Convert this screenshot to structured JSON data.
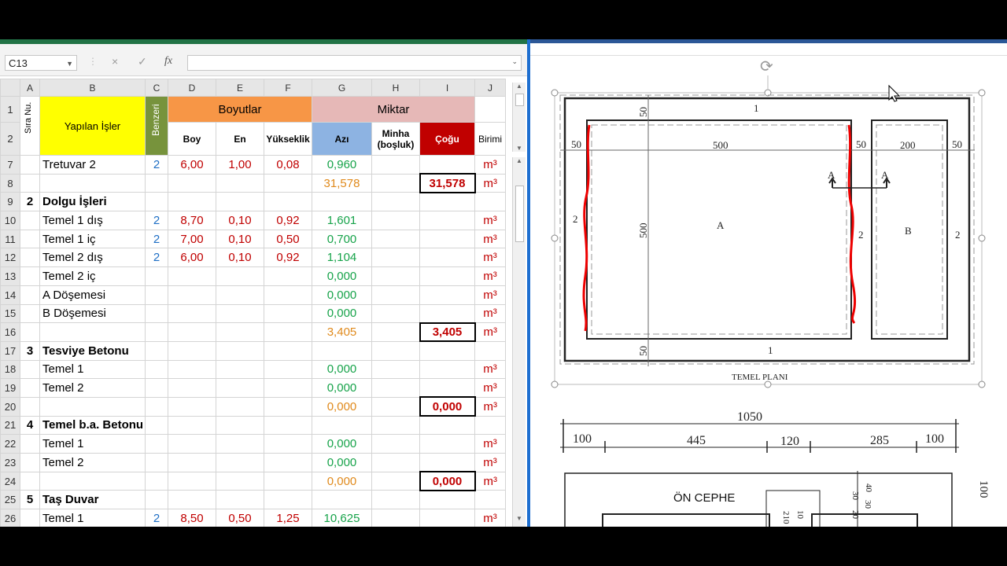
{
  "formula_bar": {
    "cell_ref": "C13",
    "cancel_glyph": "×",
    "enter_glyph": "✓",
    "fx_label": "fx",
    "formula": ""
  },
  "columns": [
    "A",
    "B",
    "C",
    "D",
    "E",
    "F",
    "G",
    "H",
    "I",
    "J"
  ],
  "header": {
    "sira_nu": "Sıra Nu.",
    "yapilan_isler": "Yapılan İşler",
    "benzeri": "Benzeri",
    "boyutlar": "Boyutlar",
    "miktar": "Miktar",
    "boy": "Boy",
    "en": "En",
    "yukseklik": "Yükseklik",
    "azi": "Azı",
    "minha": "Minha (boşluk)",
    "cogu": "Çoğu",
    "birimi": "Birimi",
    "row1": "1",
    "row2": "2"
  },
  "rows": [
    {
      "row": "7",
      "a": "",
      "b": "Tretuvar 2",
      "c": "2",
      "d": "6,00",
      "e": "1,00",
      "f": "0,08",
      "g": "0,960",
      "g_color": "green",
      "h": "",
      "i": "",
      "i_box": false,
      "j": "m³",
      "bold": false
    },
    {
      "row": "8",
      "a": "",
      "b": "",
      "c": "",
      "d": "",
      "e": "",
      "f": "",
      "g": "31,578",
      "g_color": "orange",
      "h": "",
      "i": "31,578",
      "i_box": true,
      "j": "m³",
      "bold": false
    },
    {
      "row": "9",
      "a": "2",
      "b": "Dolgu İşleri",
      "c": "",
      "d": "",
      "e": "",
      "f": "",
      "g": "",
      "g_color": "",
      "h": "",
      "i": "",
      "i_box": false,
      "j": "",
      "bold": true
    },
    {
      "row": "10",
      "a": "",
      "b": "Temel 1 dış",
      "c": "2",
      "d": "8,70",
      "e": "0,10",
      "f": "0,92",
      "g": "1,601",
      "g_color": "green",
      "h": "",
      "i": "",
      "i_box": false,
      "j": "m³",
      "bold": false
    },
    {
      "row": "11",
      "a": "",
      "b": "Temel 1 iç",
      "c": "2",
      "d": "7,00",
      "e": "0,10",
      "f": "0,50",
      "g": "0,700",
      "g_color": "green",
      "h": "",
      "i": "",
      "i_box": false,
      "j": "m³",
      "bold": false
    },
    {
      "row": "12",
      "a": "",
      "b": "Temel 2 dış",
      "c": "2",
      "d": "6,00",
      "e": "0,10",
      "f": "0,92",
      "g": "1,104",
      "g_color": "green",
      "h": "",
      "i": "",
      "i_box": false,
      "j": "m³",
      "bold": false
    },
    {
      "row": "13",
      "a": "",
      "b": "Temel 2 iç",
      "c": "",
      "d": "",
      "e": "",
      "f": "",
      "g": "0,000",
      "g_color": "green",
      "h": "",
      "i": "",
      "i_box": false,
      "j": "m³",
      "bold": false
    },
    {
      "row": "14",
      "a": "",
      "b": "A Döşemesi",
      "c": "",
      "d": "",
      "e": "",
      "f": "",
      "g": "0,000",
      "g_color": "green",
      "h": "",
      "i": "",
      "i_box": false,
      "j": "m³",
      "bold": false
    },
    {
      "row": "15",
      "a": "",
      "b": "B Döşemesi",
      "c": "",
      "d": "",
      "e": "",
      "f": "",
      "g": "0,000",
      "g_color": "green",
      "h": "",
      "i": "",
      "i_box": false,
      "j": "m³",
      "bold": false
    },
    {
      "row": "16",
      "a": "",
      "b": "",
      "c": "",
      "d": "",
      "e": "",
      "f": "",
      "g": "3,405",
      "g_color": "orange",
      "h": "",
      "i": "3,405",
      "i_box": true,
      "j": "m³",
      "bold": false
    },
    {
      "row": "17",
      "a": "3",
      "b": "Tesviye Betonu",
      "c": "",
      "d": "",
      "e": "",
      "f": "",
      "g": "",
      "g_color": "",
      "h": "",
      "i": "",
      "i_box": false,
      "j": "",
      "bold": true
    },
    {
      "row": "18",
      "a": "",
      "b": "Temel 1",
      "c": "",
      "d": "",
      "e": "",
      "f": "",
      "g": "0,000",
      "g_color": "green",
      "h": "",
      "i": "",
      "i_box": false,
      "j": "m³",
      "bold": false
    },
    {
      "row": "19",
      "a": "",
      "b": "Temel 2",
      "c": "",
      "d": "",
      "e": "",
      "f": "",
      "g": "0,000",
      "g_color": "green",
      "h": "",
      "i": "",
      "i_box": false,
      "j": "m³",
      "bold": false
    },
    {
      "row": "20",
      "a": "",
      "b": "",
      "c": "",
      "d": "",
      "e": "",
      "f": "",
      "g": "0,000",
      "g_color": "orange",
      "h": "",
      "i": "0,000",
      "i_box": true,
      "j": "m³",
      "bold": false
    },
    {
      "row": "21",
      "a": "4",
      "b": "Temel b.a. Betonu",
      "c": "",
      "d": "",
      "e": "",
      "f": "",
      "g": "",
      "g_color": "",
      "h": "",
      "i": "",
      "i_box": false,
      "j": "",
      "bold": true
    },
    {
      "row": "22",
      "a": "",
      "b": "Temel 1",
      "c": "",
      "d": "",
      "e": "",
      "f": "",
      "g": "0,000",
      "g_color": "green",
      "h": "",
      "i": "",
      "i_box": false,
      "j": "m³",
      "bold": false
    },
    {
      "row": "23",
      "a": "",
      "b": "Temel 2",
      "c": "",
      "d": "",
      "e": "",
      "f": "",
      "g": "0,000",
      "g_color": "green",
      "h": "",
      "i": "",
      "i_box": false,
      "j": "m³",
      "bold": false
    },
    {
      "row": "24",
      "a": "",
      "b": "",
      "c": "",
      "d": "",
      "e": "",
      "f": "",
      "g": "0,000",
      "g_color": "orange",
      "h": "",
      "i": "0,000",
      "i_box": true,
      "j": "m³",
      "bold": false
    },
    {
      "row": "25",
      "a": "5",
      "b": "Taş Duvar",
      "c": "",
      "d": "",
      "e": "",
      "f": "",
      "g": "",
      "g_color": "",
      "h": "",
      "i": "",
      "i_box": false,
      "j": "",
      "bold": true
    },
    {
      "row": "26",
      "a": "",
      "b": "Temel 1",
      "c": "2",
      "d": "8,50",
      "e": "0,50",
      "f": "1,25",
      "g": "10,625",
      "g_color": "green",
      "h": "",
      "i": "",
      "i_box": false,
      "j": "m³",
      "bold": false
    }
  ],
  "drawing": {
    "plan_title": "TEMEL PLANI",
    "room_a": "A",
    "room_b": "B",
    "section_a_left": "A",
    "section_a_right": "A",
    "dims": {
      "top_1": "1",
      "bottom_1": "1",
      "left_50": "50",
      "top_50": "50",
      "bottom_50": "50",
      "d500_h": "500",
      "d500_v": "500",
      "d200": "200",
      "mid_50": "50",
      "right_50": "50",
      "left_2": "2",
      "mid_2": "2",
      "right_2": "2"
    },
    "elev_total": "1050",
    "elev_dims": [
      "100",
      "445",
      "120",
      "285",
      "100"
    ],
    "on_cephe": "ÖN CEPHE",
    "side_dims": {
      "d100": "100",
      "d40": "40",
      "d30a": "30",
      "d30b": "30",
      "d20": "20",
      "d210": "210",
      "d10": "10"
    }
  },
  "colors": {
    "excel_green": "#217346",
    "boyutlar_bg": "#f79646",
    "miktar_bg": "#e6b8b7",
    "azi_bg": "#8db3e2",
    "cogu_bg": "#c00000",
    "yellow": "#ffff00",
    "benzeri_bg": "#77933c",
    "word_blue": "#2b5797"
  }
}
